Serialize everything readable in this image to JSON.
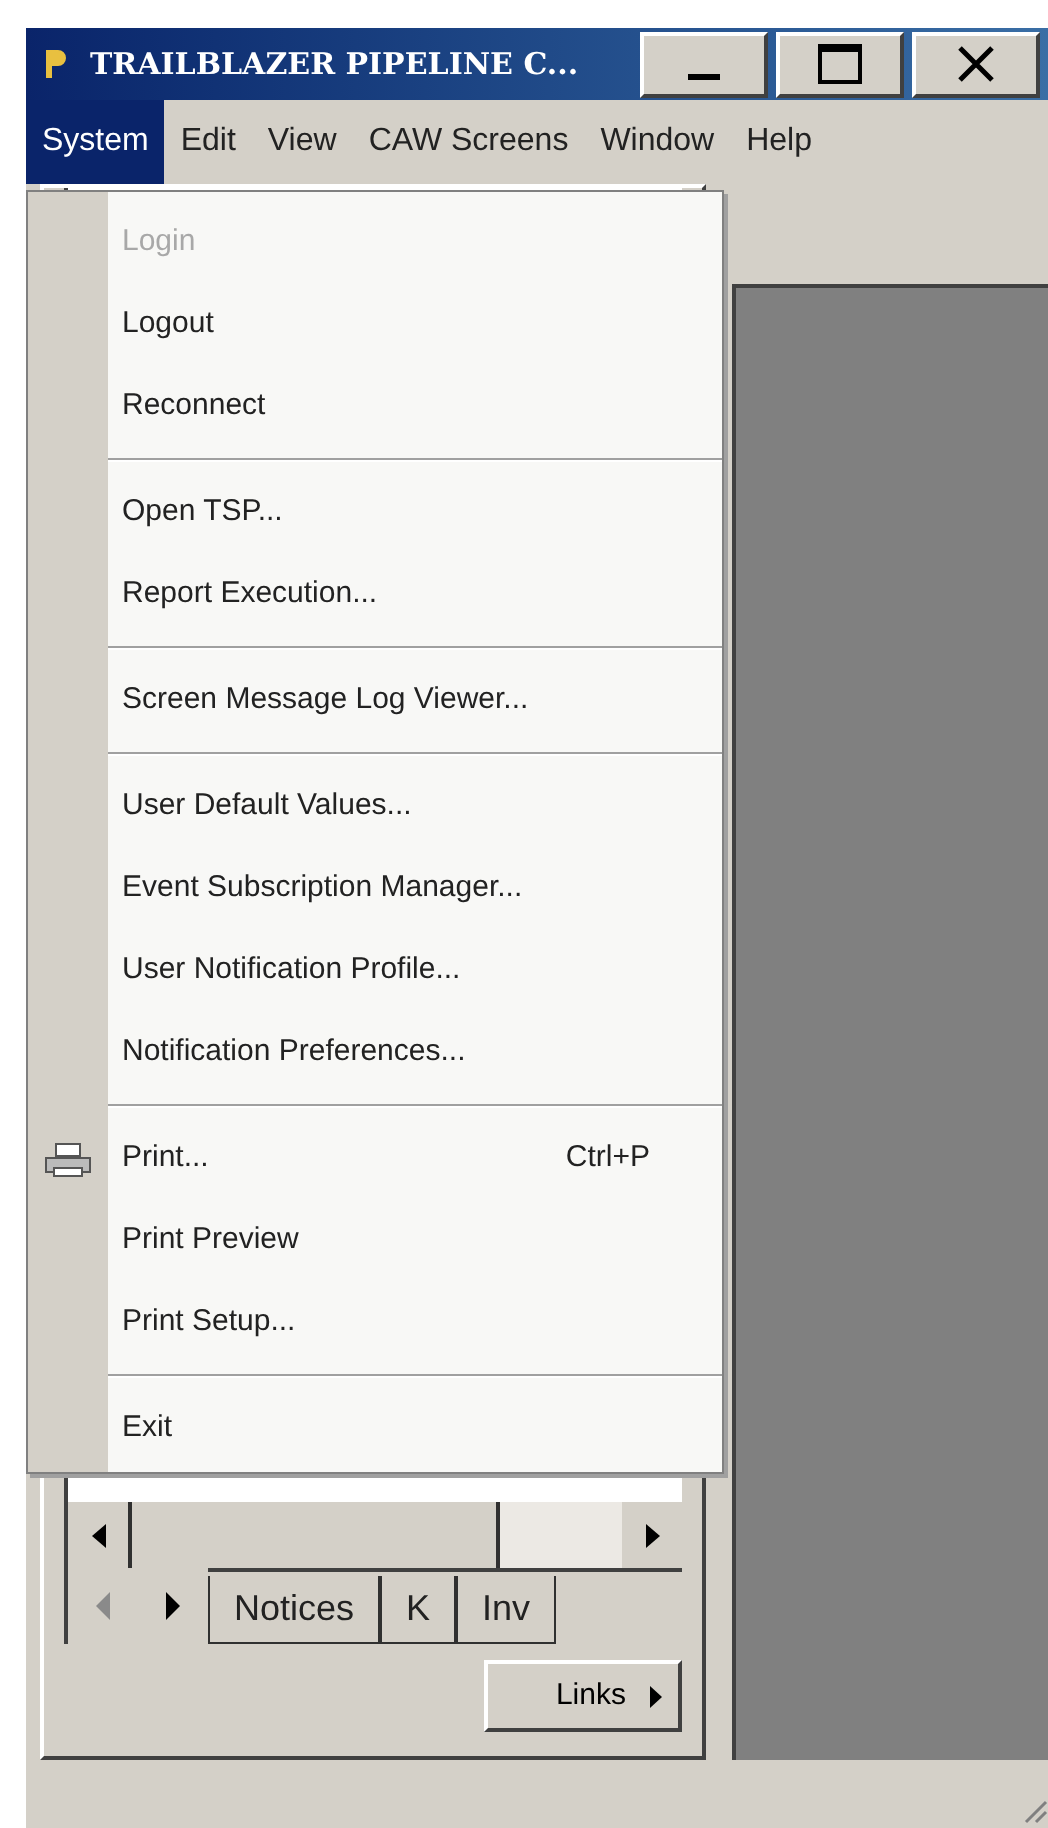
{
  "window": {
    "title": "TRAILBLAZER PIPELINE C..."
  },
  "menu_bar": [
    {
      "label": "System",
      "selected": true
    },
    {
      "label": "Edit",
      "selected": false
    },
    {
      "label": "View",
      "selected": false
    },
    {
      "label": "CAW Screens",
      "selected": false
    },
    {
      "label": "Window",
      "selected": false
    },
    {
      "label": "Help",
      "selected": false
    }
  ],
  "system_menu": [
    {
      "kind": "item",
      "label": "Login",
      "disabled": true
    },
    {
      "kind": "item",
      "label": "Logout",
      "disabled": false
    },
    {
      "kind": "item",
      "label": "Reconnect",
      "disabled": false
    },
    {
      "kind": "separator"
    },
    {
      "kind": "item",
      "label": "Open TSP...",
      "disabled": false
    },
    {
      "kind": "item",
      "label": "Report Execution...",
      "disabled": false
    },
    {
      "kind": "separator"
    },
    {
      "kind": "item",
      "label": "Screen Message Log Viewer...",
      "disabled": false
    },
    {
      "kind": "separator"
    },
    {
      "kind": "item",
      "label": "User Default Values...",
      "disabled": false
    },
    {
      "kind": "item",
      "label": "Event Subscription Manager...",
      "disabled": false
    },
    {
      "kind": "item",
      "label": "User Notification Profile...",
      "disabled": false
    },
    {
      "kind": "item",
      "label": "Notification Preferences...",
      "disabled": false
    },
    {
      "kind": "separator"
    },
    {
      "kind": "printer-item",
      "label": "Print...",
      "shortcut": "Ctrl+P",
      "disabled": false
    },
    {
      "kind": "item",
      "label": "Print Preview",
      "disabled": false
    },
    {
      "kind": "item",
      "label": "Print Setup...",
      "disabled": false
    },
    {
      "kind": "separator"
    },
    {
      "kind": "item",
      "label": "Exit",
      "disabled": false
    }
  ],
  "panel_tabs": {
    "tabs": [
      {
        "label": "Notices"
      },
      {
        "label": "K"
      },
      {
        "label": "Inv"
      }
    ]
  },
  "links_button": {
    "label": "Links"
  }
}
